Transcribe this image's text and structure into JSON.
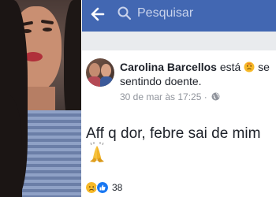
{
  "search": {
    "placeholder": "Pesquisar"
  },
  "post": {
    "author": "Carolina Barcellos",
    "status_verb": "está",
    "feeling_text_part1": "se",
    "feeling_text_part2": "sentindo doente.",
    "timestamp": "30 de mar às 17:25 ·",
    "body": "Aff q dor, febre sai de mim",
    "reaction_count": "38"
  },
  "icons": {
    "back": "back-arrow-icon",
    "search": "search-icon",
    "feeling": "sick-face-icon",
    "privacy": "globe-icon",
    "praying_hands": "praying-hands-emoji",
    "reaction_sad": "sad-reaction-icon",
    "reaction_like": "like-reaction-icon"
  },
  "colors": {
    "brand_blue": "#4267b2",
    "feed_gray": "#e9ebee",
    "text": "#1d2129",
    "meta": "#90949c",
    "like_blue": "#1877f2",
    "sad_yellow": "#f7b928"
  }
}
